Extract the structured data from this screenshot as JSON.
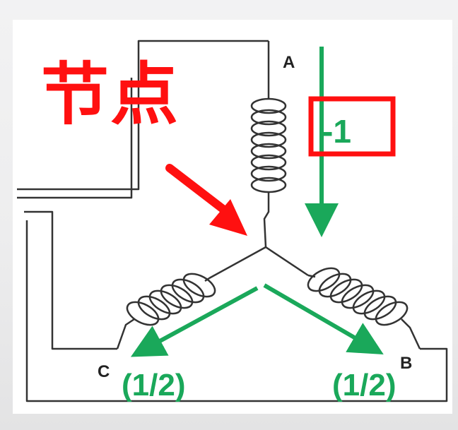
{
  "diagram": {
    "node_label": "节点",
    "phase_a": {
      "label": "A",
      "current": "-1"
    },
    "phase_b": {
      "label": "B",
      "current": "(1/2)"
    },
    "phase_c": {
      "label": "C",
      "current": "(1/2)"
    }
  },
  "colors": {
    "wire": "#333333",
    "arrow_green": "#1aa85a",
    "highlight_red": "#ff1010"
  },
  "icons": {
    "pointer": "red-arrow-icon",
    "current_arrow": "green-arrow-icon"
  }
}
